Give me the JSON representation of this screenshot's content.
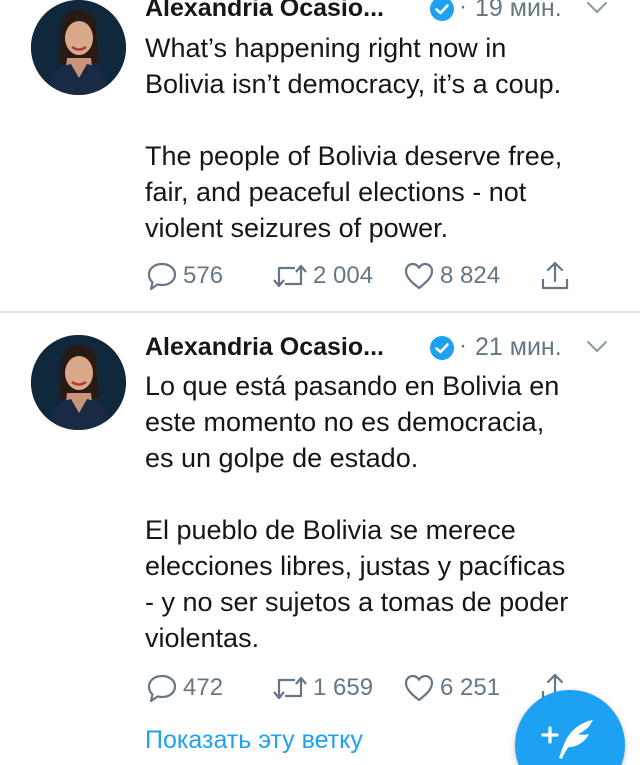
{
  "tweets": [
    {
      "author": "Alexandria Ocasio...",
      "time": "19 мин.",
      "text_lines_1": [
        "What’s happening right now in",
        "Bolivia isn’t democracy, it’s a coup."
      ],
      "text_lines_2": [
        "The people of Bolivia deserve free,",
        "fair, and peaceful elections - not",
        "violent seizures of power."
      ],
      "replies": "576",
      "retweets": "2 004",
      "likes": "8 824"
    },
    {
      "author": "Alexandria Ocasio...",
      "time": "21 мин.",
      "text_lines_1": [
        "Lo que está pasando en Bolivia en",
        "este momento no es democracia,",
        "es un golpe de estado."
      ],
      "text_lines_2": [
        "El pueblo de Bolivia se merece",
        "elecciones libres, justas y pacíficas",
        "- y no ser sujetos a tomas de poder",
        "violentas."
      ],
      "replies": "472",
      "retweets": "1 659",
      "likes": "6 251"
    }
  ],
  "show_thread_label": "Показать эту ветку",
  "separator": "·",
  "icons": {
    "verified": "verified-badge-icon",
    "chevron": "chevron-down-icon",
    "reply": "reply-icon",
    "retweet": "retweet-icon",
    "like": "heart-icon",
    "share": "share-icon",
    "compose": "compose-tweet-icon"
  },
  "colors": {
    "accent": "#1da1f2",
    "muted": "#657786",
    "text": "#14171a",
    "divider": "#e1e8ed"
  }
}
